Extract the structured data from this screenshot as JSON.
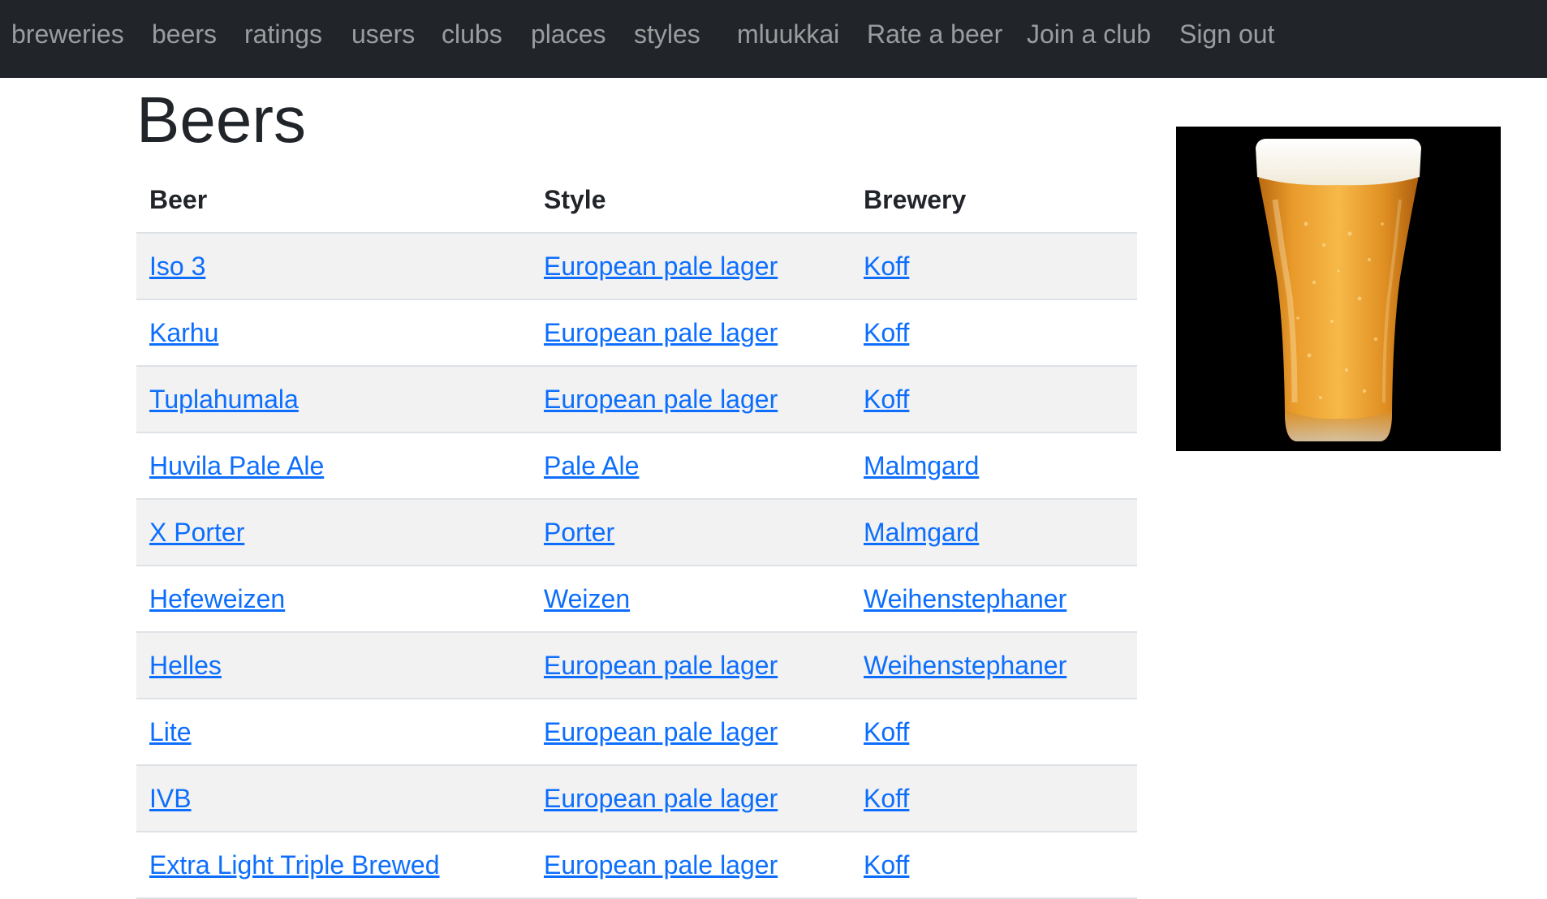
{
  "nav": {
    "items": [
      {
        "label": "breweries"
      },
      {
        "label": "beers"
      },
      {
        "label": "ratings"
      },
      {
        "label": "users"
      },
      {
        "label": "clubs"
      },
      {
        "label": "places"
      },
      {
        "label": "styles"
      },
      {
        "label": "mluukkai"
      },
      {
        "label": "Rate a beer"
      },
      {
        "label": "Join a club"
      },
      {
        "label": "Sign out"
      }
    ]
  },
  "page": {
    "title": "Beers"
  },
  "table": {
    "headers": [
      "Beer",
      "Style",
      "Brewery"
    ],
    "rows": [
      {
        "beer": "Iso 3",
        "style": "European pale lager",
        "brewery": "Koff"
      },
      {
        "beer": "Karhu",
        "style": "European pale lager",
        "brewery": "Koff"
      },
      {
        "beer": "Tuplahumala",
        "style": "European pale lager",
        "brewery": "Koff"
      },
      {
        "beer": "Huvila Pale Ale",
        "style": "Pale Ale",
        "brewery": "Malmgard"
      },
      {
        "beer": "X Porter",
        "style": "Porter",
        "brewery": "Malmgard"
      },
      {
        "beer": "Hefeweizen",
        "style": "Weizen",
        "brewery": "Weihenstephaner"
      },
      {
        "beer": "Helles",
        "style": "European pale lager",
        "brewery": "Weihenstephaner"
      },
      {
        "beer": "Lite",
        "style": "European pale lager",
        "brewery": "Koff"
      },
      {
        "beer": "IVB",
        "style": "European pale lager",
        "brewery": "Koff"
      },
      {
        "beer": "Extra Light Triple Brewed",
        "style": "European pale lager",
        "brewery": "Koff"
      }
    ]
  },
  "image": {
    "icon": "beer-glass-icon"
  },
  "colors": {
    "navbar": "#212529",
    "nav_text": "#8c8e90",
    "link": "#0d6efd",
    "stripe": "#f2f2f2",
    "image_bg": "#000000"
  }
}
